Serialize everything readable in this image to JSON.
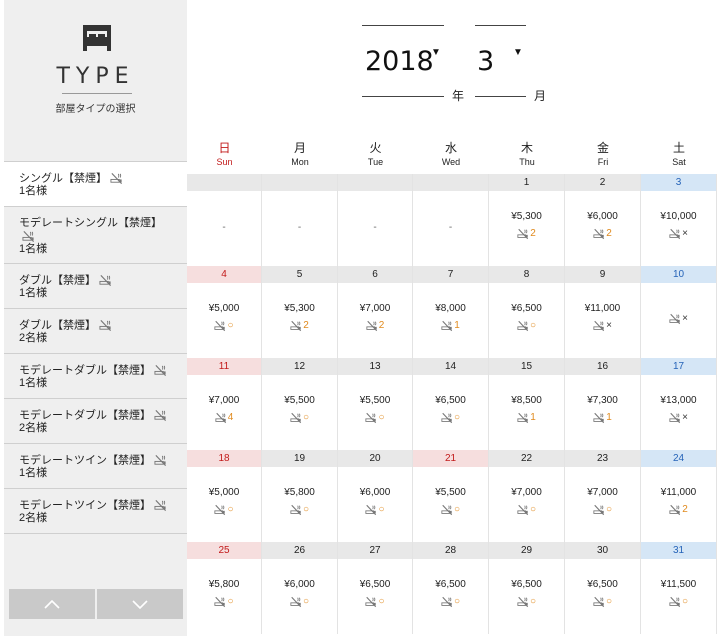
{
  "sidebar": {
    "title": "TYPE",
    "subtitle": "部屋タイプの選択",
    "rooms": [
      {
        "name": "シングル【禁煙】",
        "cap": "1名様"
      },
      {
        "name": "モデレートシングル【禁煙】",
        "cap": "1名様"
      },
      {
        "name": "ダブル【禁煙】",
        "cap": "1名様"
      },
      {
        "name": "ダブル【禁煙】",
        "cap": "2名様"
      },
      {
        "name": "モデレートダブル【禁煙】",
        "cap": "1名様"
      },
      {
        "name": "モデレートダブル【禁煙】",
        "cap": "2名様"
      },
      {
        "name": "モデレートツイン【禁煙】",
        "cap": "1名様"
      },
      {
        "name": "モデレートツイン【禁煙】",
        "cap": "2名様"
      }
    ]
  },
  "date": {
    "year": "2018",
    "month": "3",
    "year_unit": "年",
    "month_unit": "月"
  },
  "days_of_week": [
    {
      "jp": "日",
      "en": "Sun"
    },
    {
      "jp": "月",
      "en": "Mon"
    },
    {
      "jp": "火",
      "en": "Tue"
    },
    {
      "jp": "水",
      "en": "Wed"
    },
    {
      "jp": "木",
      "en": "Thu"
    },
    {
      "jp": "金",
      "en": "Fri"
    },
    {
      "jp": "土",
      "en": "Sat"
    }
  ],
  "weeks": [
    [
      {
        "day": "",
        "price": null,
        "mark": null
      },
      {
        "day": "",
        "price": null,
        "mark": null
      },
      {
        "day": "",
        "price": null,
        "mark": null
      },
      {
        "day": "",
        "price": null,
        "mark": null
      },
      {
        "day": "1",
        "price": "¥5,300",
        "mark": "2"
      },
      {
        "day": "2",
        "price": "¥6,000",
        "mark": "2"
      },
      {
        "day": "3",
        "price": "¥10,000",
        "mark": "×"
      }
    ],
    [
      {
        "day": "4",
        "price": "¥5,000",
        "mark": "○"
      },
      {
        "day": "5",
        "price": "¥5,300",
        "mark": "2"
      },
      {
        "day": "6",
        "price": "¥7,000",
        "mark": "2"
      },
      {
        "day": "7",
        "price": "¥8,000",
        "mark": "1"
      },
      {
        "day": "8",
        "price": "¥6,500",
        "mark": "○"
      },
      {
        "day": "9",
        "price": "¥11,000",
        "mark": "×"
      },
      {
        "day": "10",
        "price": "",
        "mark": "×"
      }
    ],
    [
      {
        "day": "11",
        "price": "¥7,000",
        "mark": "4"
      },
      {
        "day": "12",
        "price": "¥5,500",
        "mark": "○"
      },
      {
        "day": "13",
        "price": "¥5,500",
        "mark": "○"
      },
      {
        "day": "14",
        "price": "¥6,500",
        "mark": "○"
      },
      {
        "day": "15",
        "price": "¥8,500",
        "mark": "1"
      },
      {
        "day": "16",
        "price": "¥7,300",
        "mark": "1"
      },
      {
        "day": "17",
        "price": "¥13,000",
        "mark": "×"
      }
    ],
    [
      {
        "day": "18",
        "price": "¥5,000",
        "mark": "○"
      },
      {
        "day": "19",
        "price": "¥5,800",
        "mark": "○"
      },
      {
        "day": "20",
        "price": "¥6,000",
        "mark": "○"
      },
      {
        "day": "21",
        "price": "¥5,500",
        "mark": "○",
        "holiday": true
      },
      {
        "day": "22",
        "price": "¥7,000",
        "mark": "○"
      },
      {
        "day": "23",
        "price": "¥7,000",
        "mark": "○"
      },
      {
        "day": "24",
        "price": "¥11,000",
        "mark": "2"
      }
    ],
    [
      {
        "day": "25",
        "price": "¥5,800",
        "mark": "○"
      },
      {
        "day": "26",
        "price": "¥6,000",
        "mark": "○"
      },
      {
        "day": "27",
        "price": "¥6,500",
        "mark": "○"
      },
      {
        "day": "28",
        "price": "¥6,500",
        "mark": "○"
      },
      {
        "day": "29",
        "price": "¥6,500",
        "mark": "○"
      },
      {
        "day": "30",
        "price": "¥6,500",
        "mark": "○"
      },
      {
        "day": "31",
        "price": "¥11,500",
        "mark": "○"
      }
    ]
  ],
  "empty_text": "-",
  "colors": {
    "sunday": "#c21a1a",
    "saturday": "#2563b8",
    "available": "#e08a1e"
  }
}
